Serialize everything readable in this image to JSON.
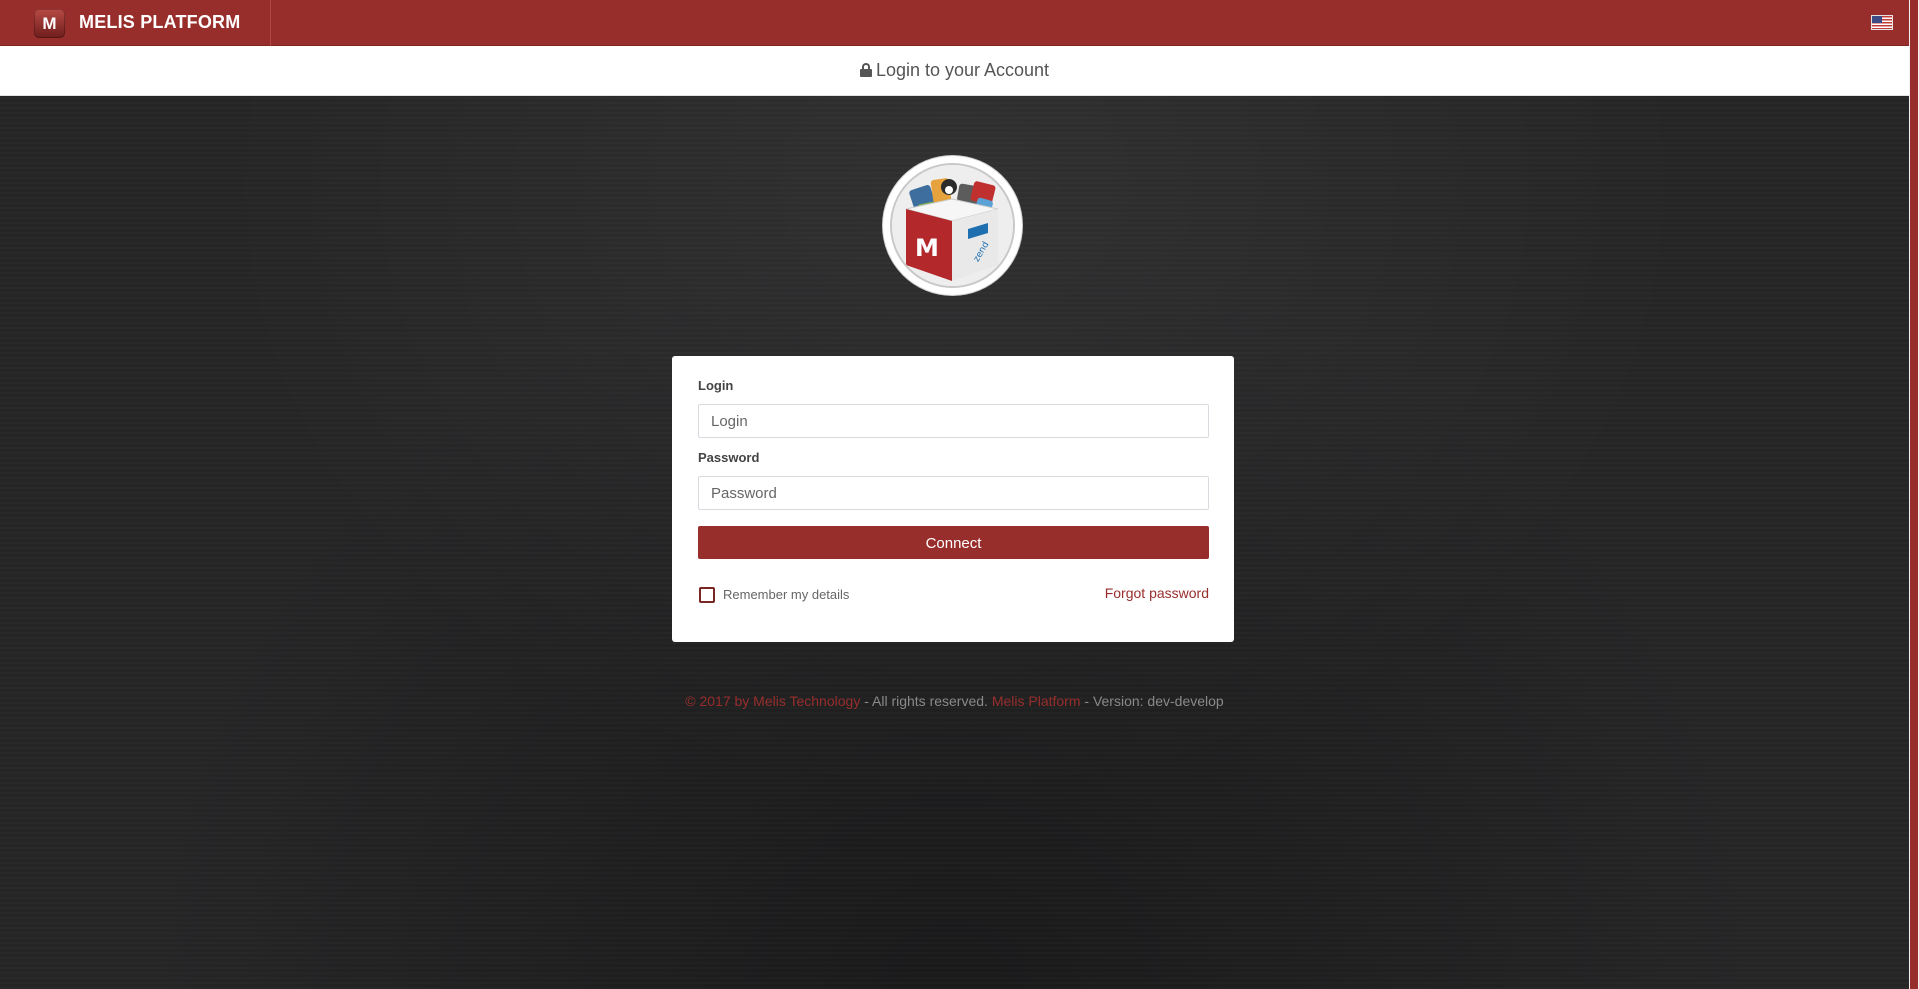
{
  "header": {
    "logo_letter": "M",
    "brand_title": "MELIS PLATFORM",
    "language_flag": "us-flag-icon"
  },
  "login_strip": {
    "icon": "lock-icon",
    "title": "Login to your Account"
  },
  "logo": {
    "icon": "melis-box-logo",
    "letter": "M",
    "side_text": "zend"
  },
  "form": {
    "login_label": "Login",
    "login_placeholder": "Login",
    "login_value": "",
    "password_label": "Password",
    "password_placeholder": "Password",
    "password_value": "",
    "connect_label": "Connect",
    "remember_label": "Remember my details",
    "remember_checked": false,
    "forgot_label": "Forgot password"
  },
  "footer": {
    "copyright_link": "© 2017 by Melis Technology",
    "rights_text": " - All rights reserved. ",
    "platform_link": "Melis Platform",
    "version_text": " - Version: dev-develop"
  },
  "colors": {
    "brand": "#982e2c",
    "background": "#222223",
    "card": "#ffffff"
  }
}
